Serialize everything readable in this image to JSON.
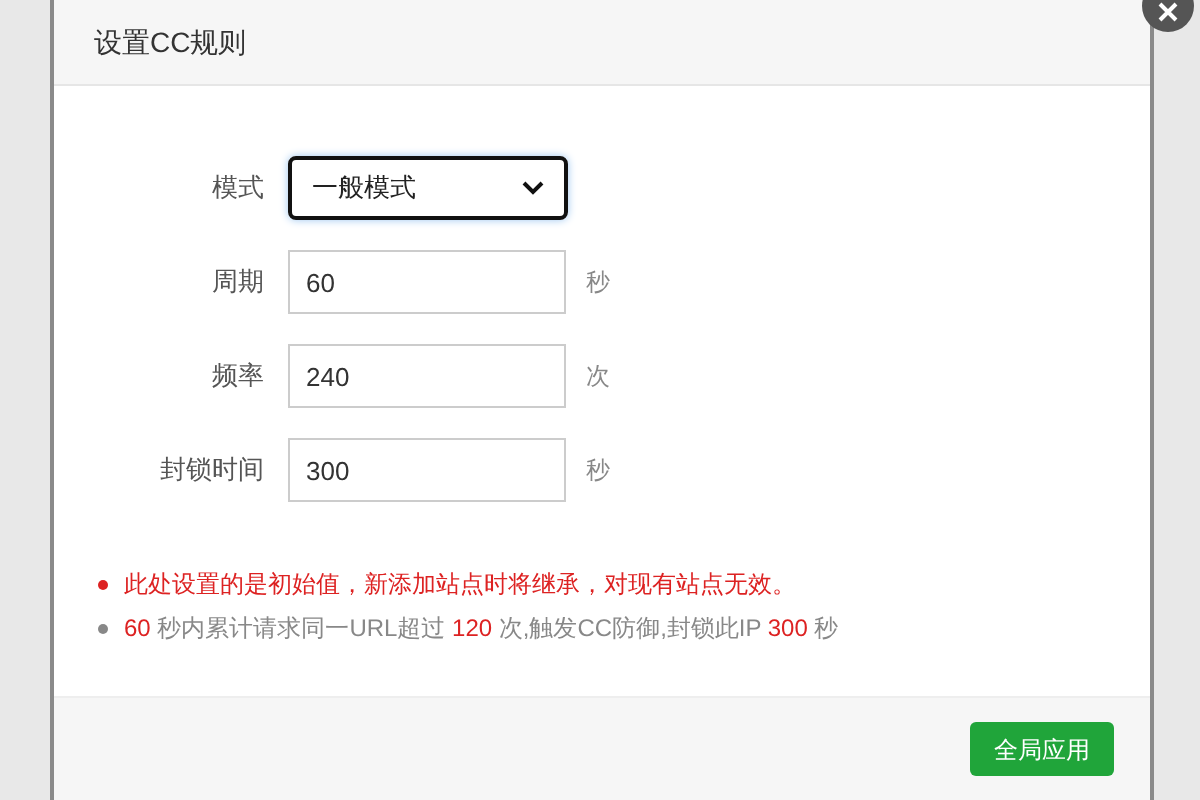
{
  "dialog": {
    "title": "设置CC规则"
  },
  "fields": [
    {
      "kind": "select",
      "label": "模式",
      "value": "一般模式"
    },
    {
      "kind": "input",
      "label": "周期",
      "value": "60",
      "unit": "秒"
    },
    {
      "kind": "input",
      "label": "频率",
      "value": "240",
      "unit": "次"
    },
    {
      "kind": "input",
      "label": "封锁时间",
      "value": "300",
      "unit": "秒"
    }
  ],
  "notes": [
    {
      "color": "#dd2222",
      "text": "此处设置的是初始值，新添加站点时将继承，对现有站点无效。"
    },
    {
      "color": "#888888",
      "parts": [
        {
          "text": "60",
          "highlight": true
        },
        {
          "text": " 秒内累计请求同一URL超过 ",
          "highlight": false
        },
        {
          "text": "120",
          "highlight": true
        },
        {
          "text": " 次,触发CC防御,封锁此IP ",
          "highlight": false
        },
        {
          "text": "300",
          "highlight": true
        },
        {
          "text": " 秒",
          "highlight": false
        }
      ]
    }
  ],
  "buttons": [
    {
      "label": "全局应用"
    }
  ]
}
